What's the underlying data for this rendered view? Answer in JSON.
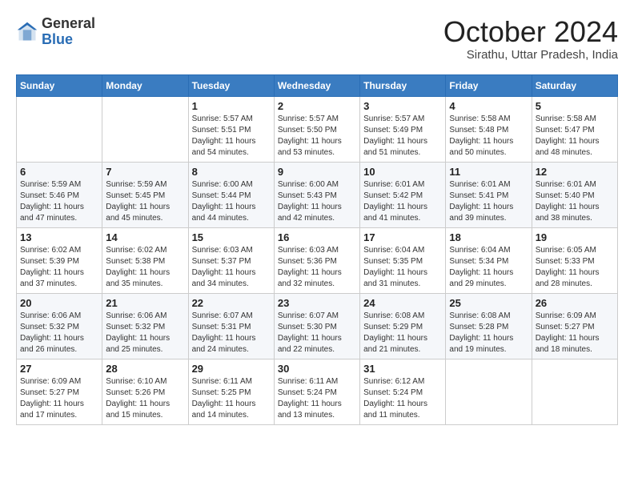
{
  "logo": {
    "general": "General",
    "blue": "Blue"
  },
  "header": {
    "month": "October 2024",
    "location": "Sirathu, Uttar Pradesh, India"
  },
  "weekdays": [
    "Sunday",
    "Monday",
    "Tuesday",
    "Wednesday",
    "Thursday",
    "Friday",
    "Saturday"
  ],
  "weeks": [
    [
      null,
      null,
      {
        "day": 1,
        "sunrise": "5:57 AM",
        "sunset": "5:51 PM",
        "daylight": "11 hours and 54 minutes."
      },
      {
        "day": 2,
        "sunrise": "5:57 AM",
        "sunset": "5:50 PM",
        "daylight": "11 hours and 53 minutes."
      },
      {
        "day": 3,
        "sunrise": "5:57 AM",
        "sunset": "5:49 PM",
        "daylight": "11 hours and 51 minutes."
      },
      {
        "day": 4,
        "sunrise": "5:58 AM",
        "sunset": "5:48 PM",
        "daylight": "11 hours and 50 minutes."
      },
      {
        "day": 5,
        "sunrise": "5:58 AM",
        "sunset": "5:47 PM",
        "daylight": "11 hours and 48 minutes."
      }
    ],
    [
      {
        "day": 6,
        "sunrise": "5:59 AM",
        "sunset": "5:46 PM",
        "daylight": "11 hours and 47 minutes."
      },
      {
        "day": 7,
        "sunrise": "5:59 AM",
        "sunset": "5:45 PM",
        "daylight": "11 hours and 45 minutes."
      },
      {
        "day": 8,
        "sunrise": "6:00 AM",
        "sunset": "5:44 PM",
        "daylight": "11 hours and 44 minutes."
      },
      {
        "day": 9,
        "sunrise": "6:00 AM",
        "sunset": "5:43 PM",
        "daylight": "11 hours and 42 minutes."
      },
      {
        "day": 10,
        "sunrise": "6:01 AM",
        "sunset": "5:42 PM",
        "daylight": "11 hours and 41 minutes."
      },
      {
        "day": 11,
        "sunrise": "6:01 AM",
        "sunset": "5:41 PM",
        "daylight": "11 hours and 39 minutes."
      },
      {
        "day": 12,
        "sunrise": "6:01 AM",
        "sunset": "5:40 PM",
        "daylight": "11 hours and 38 minutes."
      }
    ],
    [
      {
        "day": 13,
        "sunrise": "6:02 AM",
        "sunset": "5:39 PM",
        "daylight": "11 hours and 37 minutes."
      },
      {
        "day": 14,
        "sunrise": "6:02 AM",
        "sunset": "5:38 PM",
        "daylight": "11 hours and 35 minutes."
      },
      {
        "day": 15,
        "sunrise": "6:03 AM",
        "sunset": "5:37 PM",
        "daylight": "11 hours and 34 minutes."
      },
      {
        "day": 16,
        "sunrise": "6:03 AM",
        "sunset": "5:36 PM",
        "daylight": "11 hours and 32 minutes."
      },
      {
        "day": 17,
        "sunrise": "6:04 AM",
        "sunset": "5:35 PM",
        "daylight": "11 hours and 31 minutes."
      },
      {
        "day": 18,
        "sunrise": "6:04 AM",
        "sunset": "5:34 PM",
        "daylight": "11 hours and 29 minutes."
      },
      {
        "day": 19,
        "sunrise": "6:05 AM",
        "sunset": "5:33 PM",
        "daylight": "11 hours and 28 minutes."
      }
    ],
    [
      {
        "day": 20,
        "sunrise": "6:06 AM",
        "sunset": "5:32 PM",
        "daylight": "11 hours and 26 minutes."
      },
      {
        "day": 21,
        "sunrise": "6:06 AM",
        "sunset": "5:32 PM",
        "daylight": "11 hours and 25 minutes."
      },
      {
        "day": 22,
        "sunrise": "6:07 AM",
        "sunset": "5:31 PM",
        "daylight": "11 hours and 24 minutes."
      },
      {
        "day": 23,
        "sunrise": "6:07 AM",
        "sunset": "5:30 PM",
        "daylight": "11 hours and 22 minutes."
      },
      {
        "day": 24,
        "sunrise": "6:08 AM",
        "sunset": "5:29 PM",
        "daylight": "11 hours and 21 minutes."
      },
      {
        "day": 25,
        "sunrise": "6:08 AM",
        "sunset": "5:28 PM",
        "daylight": "11 hours and 19 minutes."
      },
      {
        "day": 26,
        "sunrise": "6:09 AM",
        "sunset": "5:27 PM",
        "daylight": "11 hours and 18 minutes."
      }
    ],
    [
      {
        "day": 27,
        "sunrise": "6:09 AM",
        "sunset": "5:27 PM",
        "daylight": "11 hours and 17 minutes."
      },
      {
        "day": 28,
        "sunrise": "6:10 AM",
        "sunset": "5:26 PM",
        "daylight": "11 hours and 15 minutes."
      },
      {
        "day": 29,
        "sunrise": "6:11 AM",
        "sunset": "5:25 PM",
        "daylight": "11 hours and 14 minutes."
      },
      {
        "day": 30,
        "sunrise": "6:11 AM",
        "sunset": "5:24 PM",
        "daylight": "11 hours and 13 minutes."
      },
      {
        "day": 31,
        "sunrise": "6:12 AM",
        "sunset": "5:24 PM",
        "daylight": "11 hours and 11 minutes."
      },
      null,
      null
    ]
  ]
}
